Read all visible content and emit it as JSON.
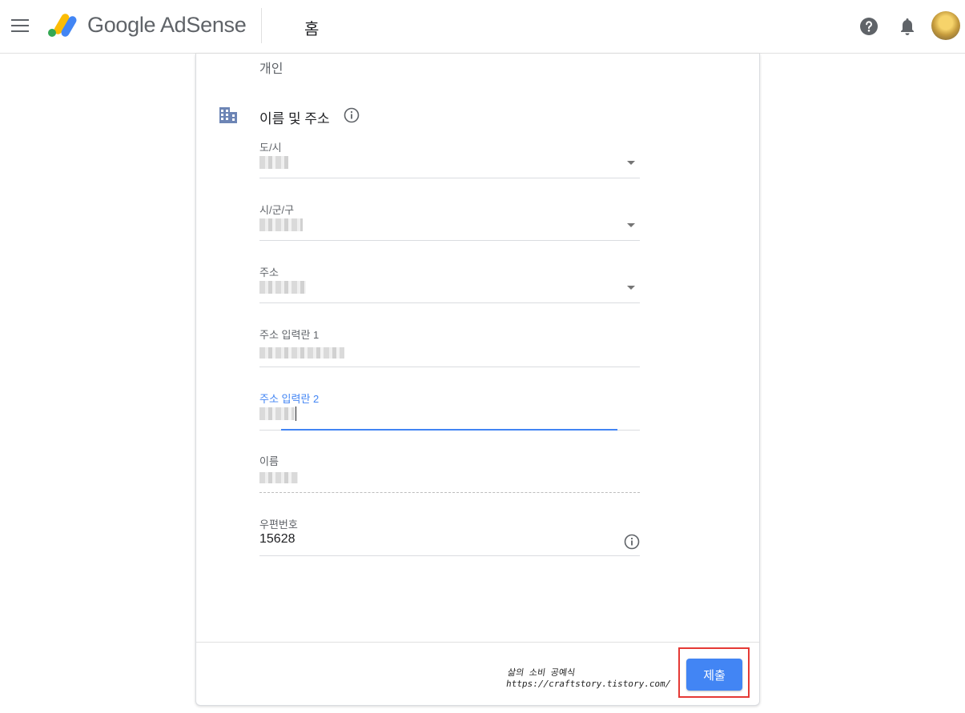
{
  "header": {
    "app_name": "Google AdSense",
    "page_title": "홈"
  },
  "form": {
    "previous_section_value": "개인",
    "section_title": "이름 및 주소",
    "fields": {
      "city": {
        "label": "도/시"
      },
      "district": {
        "label": "시/군/구"
      },
      "address": {
        "label": "주소"
      },
      "address_line1": {
        "label": "주소 입력란 1"
      },
      "address_line2": {
        "label": "주소 입력란 2"
      },
      "name": {
        "label": "이름"
      },
      "postal_code": {
        "label": "우편번호",
        "value": "15628"
      }
    }
  },
  "footer": {
    "watermark_line1": "삶의 소비 공예식",
    "watermark_line2": "https://craftstory.tistory.com/",
    "submit_label": "제출"
  },
  "colors": {
    "accent": "#4285f4",
    "highlight_border": "#e53935"
  },
  "icons": [
    "menu-icon",
    "adsense-logo-icon",
    "help-icon",
    "bell-icon",
    "building-icon",
    "info-icon",
    "dropdown-arrow-icon"
  ]
}
